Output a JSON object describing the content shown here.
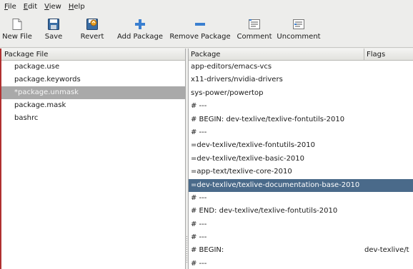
{
  "menubar": {
    "items": [
      {
        "mnemonic": "F",
        "rest": "ile"
      },
      {
        "mnemonic": "E",
        "rest": "dit"
      },
      {
        "mnemonic": "V",
        "rest": "iew"
      },
      {
        "mnemonic": "H",
        "rest": "elp"
      }
    ]
  },
  "toolbar": {
    "new_file": "New File",
    "save": "Save",
    "revert": "Revert",
    "add_package": "Add Package",
    "remove_package": "Remove Package",
    "comment": "Comment",
    "uncomment": "Uncomment"
  },
  "left_pane": {
    "header": "Package File",
    "files": [
      "package.use",
      "package.keywords",
      "*package.unmask",
      "package.mask",
      "bashrc"
    ],
    "selected_index": 2
  },
  "right_pane": {
    "headers": {
      "package": "Package",
      "flags": "Flags"
    },
    "entries": [
      {
        "package": "app-editors/emacs-vcs",
        "flags": ""
      },
      {
        "package": "x11-drivers/nvidia-drivers",
        "flags": ""
      },
      {
        "package": "sys-power/powertop",
        "flags": ""
      },
      {
        "package": "# ---",
        "flags": ""
      },
      {
        "package": "# BEGIN: dev-texlive/texlive-fontutils-2010",
        "flags": ""
      },
      {
        "package": "# ---",
        "flags": ""
      },
      {
        "package": "=dev-texlive/texlive-fontutils-2010",
        "flags": ""
      },
      {
        "package": "=dev-texlive/texlive-basic-2010",
        "flags": ""
      },
      {
        "package": "=app-text/texlive-core-2010",
        "flags": ""
      },
      {
        "package": "=dev-texlive/texlive-documentation-base-2010",
        "flags": ""
      },
      {
        "package": "# ---",
        "flags": ""
      },
      {
        "package": "# END: dev-texlive/texlive-fontutils-2010",
        "flags": ""
      },
      {
        "package": "# ---",
        "flags": ""
      },
      {
        "package": "# ---",
        "flags": ""
      },
      {
        "package": "# BEGIN:",
        "flags": "dev-texlive/t"
      },
      {
        "package": "# ---",
        "flags": ""
      }
    ],
    "selected_index": 9
  },
  "colors": {
    "selection_right": "#4a6a8a",
    "selection_left": "#a9a9a9",
    "left_border": "#b03030"
  }
}
